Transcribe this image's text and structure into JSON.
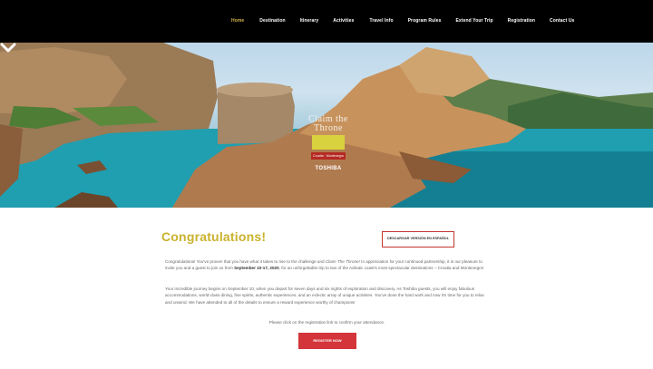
{
  "nav": {
    "items": [
      "Home",
      "Destination",
      "Itinerary",
      "Activities",
      "Travel Info",
      "Program Rules",
      "Extend Your Trip",
      "Registration",
      "Contact Us"
    ],
    "active_index": 0
  },
  "hero": {
    "logo_title": "Claim the Throne",
    "logo_countries": "Croatia · Montenegro",
    "brand": "TOSHIBA"
  },
  "main": {
    "heading": "Congratulations!",
    "spanish_button": "DESCARGAR VERSIÓN EN ESPAÑOL",
    "p1_a": "Congratulations! You've proven that you have what it takes to rise to the challenge and ",
    "p1_em": "Claim The Throne!",
    "p1_b": " In appreciation for your continued partnership, it is our pleasure to invite you and a guest to join us from ",
    "p1_strong": "September 10-17, 2020",
    "p1_c": ", for an unforgettable trip to two of the Adriatic coast's most spectacular destinations – Croatia and Montenegro!",
    "p2": "Your incredible journey begins on September 10, when you depart for seven days and six nights of exploration and discovery. As Toshiba guests, you will enjoy fabulous accommodations, world-class dining, fine spirits, authentic experiences, and an eclectic array of unique activities. You've done the hard work and now it's time for you to relax and unwind. We have attended to all of the details to ensure a reward experience worthy of champions!",
    "p3": "Please click on the registration link to confirm your attendance.",
    "register_button": "REGISTER NOW"
  },
  "colors": {
    "accent_gold": "#c9b22e",
    "button_red": "#d3353a",
    "nav_active": "#d6b24a"
  }
}
